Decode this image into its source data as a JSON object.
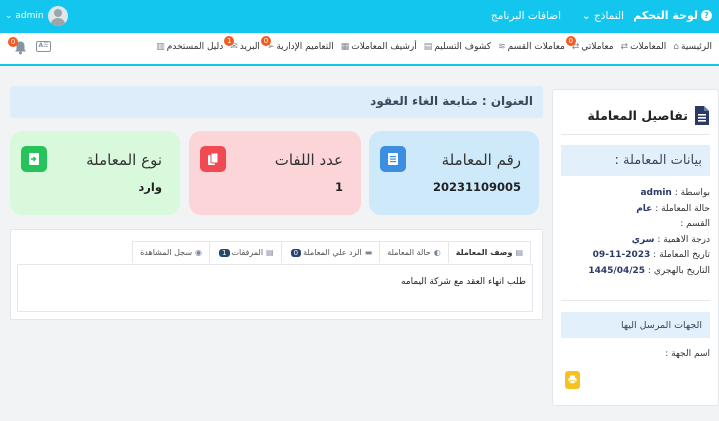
{
  "topbar": {
    "brand": "لوحة التحكم",
    "menu": [
      "النماذج",
      "اضافات البرنامج"
    ],
    "user": "admin"
  },
  "navbar": {
    "items": [
      {
        "label": "الرئيسية",
        "icon": "home-icon"
      },
      {
        "label": "المعاملات",
        "icon": "exchange-icon"
      },
      {
        "label": "معاملاتي",
        "icon": "exchange-icon",
        "badge": "0"
      },
      {
        "label": "معاملات القسم",
        "icon": "layers-icon"
      },
      {
        "label": "كشوف التسليم",
        "icon": "file-icon"
      },
      {
        "label": "أرشيف المعاملات",
        "icon": "archive-icon"
      },
      {
        "label": "التعاميم الإدارية",
        "icon": "send-icon",
        "badge": "0"
      },
      {
        "label": "البريد",
        "icon": "mail-icon",
        "badge": "1"
      },
      {
        "label": "دليل المستخدم",
        "icon": "book-icon"
      }
    ],
    "bell_badge": "0",
    "id_card_text": "A☰"
  },
  "details": {
    "heading": "تفاصيل المعاملة",
    "data_heading": "بيانات المعاملة :",
    "fields": [
      {
        "label": "بواسطة :",
        "value": "admin"
      },
      {
        "label": "حالة المعاملة :",
        "value": "عام"
      },
      {
        "label": "القسم :",
        "value": ""
      },
      {
        "label": "درجة الاهمية :",
        "value": "سري"
      },
      {
        "label": "تاريخ المعاملة :",
        "value": "2023-11-09"
      },
      {
        "label": "التاريخ بالهجري :",
        "value": "1445/04/25"
      }
    ],
    "recipients_heading": "الجهات المرسل اليها",
    "recipient_name_label": "اسم الجهة :"
  },
  "main": {
    "title": "العنوان : متابعة الغاء العقود",
    "cards": [
      {
        "label": "رقم المعاملة",
        "value": "20231109005",
        "color": "#3b8ee0"
      },
      {
        "label": "عدد اللفات",
        "value": "1",
        "color": "#f04b52"
      },
      {
        "label": "نوع المعاملة",
        "value": "وارد",
        "color": "#26c25a"
      }
    ],
    "tabs": [
      {
        "label": "وصف المعاملة",
        "icon": "file-icon"
      },
      {
        "label": "حالة المعاملة",
        "icon": "half-circle-icon"
      },
      {
        "label": "الرد علي المعاملة",
        "icon": "comment-icon",
        "badge": "0"
      },
      {
        "label": "المرفقات",
        "icon": "file-icon",
        "badge": "1"
      },
      {
        "label": "سجل المشاهدة",
        "icon": "eye-icon"
      }
    ],
    "description": "طلب انهاء العقد مع شركة اليمامه"
  }
}
